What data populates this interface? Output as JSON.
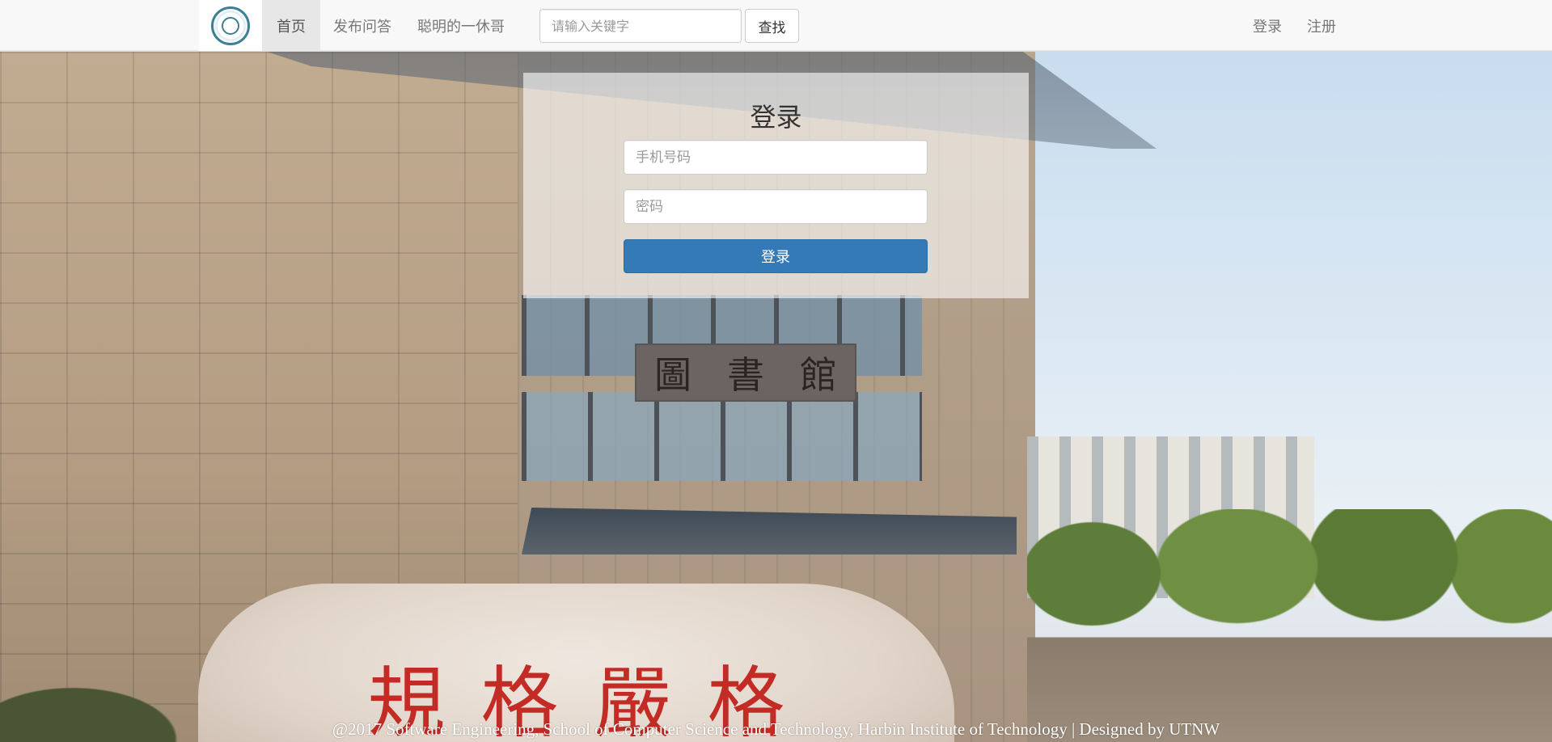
{
  "navbar": {
    "logo_icon": "university-seal-icon",
    "links": [
      {
        "label": "首页",
        "active": true
      },
      {
        "label": "发布问答",
        "active": false
      },
      {
        "label": "聪明的一休哥",
        "active": false
      }
    ],
    "search": {
      "placeholder": "请输入关键字",
      "value": "",
      "button_label": "查找"
    },
    "right_links": [
      {
        "label": "登录"
      },
      {
        "label": "注册"
      }
    ]
  },
  "background": {
    "sign_chars": [
      "圖",
      "書",
      "館"
    ],
    "rock_chars": [
      "規",
      "格",
      "嚴",
      "格"
    ]
  },
  "login": {
    "title": "登录",
    "phone_placeholder": "手机号码",
    "phone_value": "",
    "password_placeholder": "密码",
    "password_value": "",
    "submit_label": "登录",
    "accent_color": "#337ab7"
  },
  "footer": {
    "text": "@2017 Software Engineering, School of Computer Science and Technology, Harbin Institute of Technology | Designed by UTNW"
  }
}
